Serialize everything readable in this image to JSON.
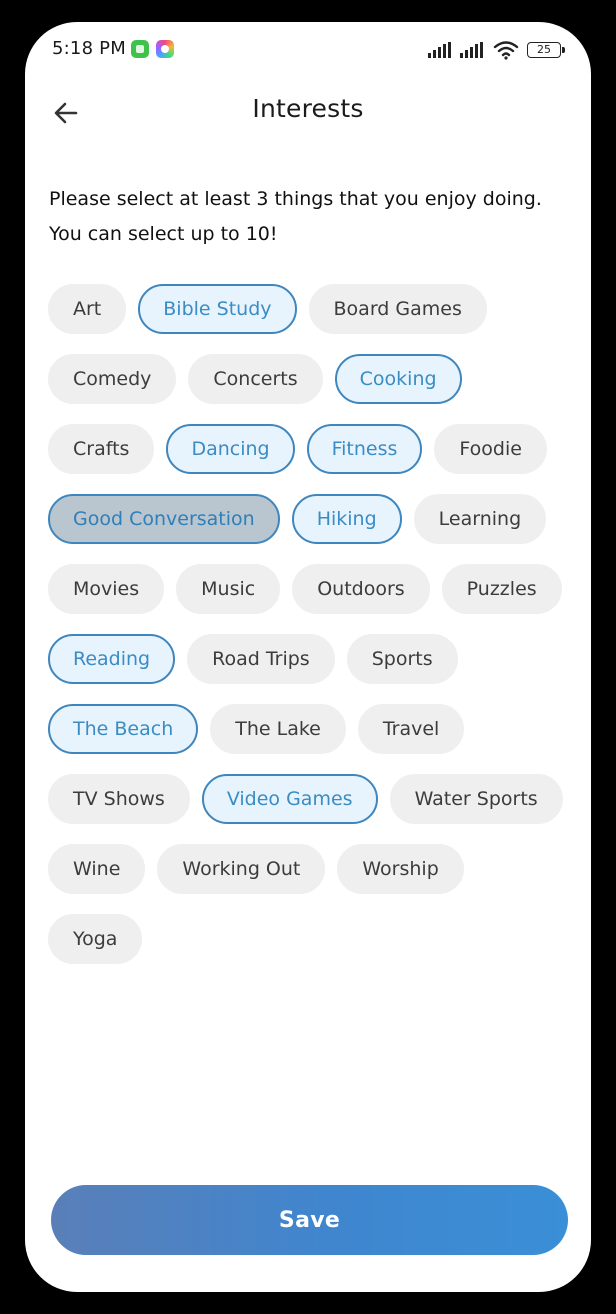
{
  "status_bar": {
    "time": "5:18 PM",
    "battery": "25"
  },
  "header": {
    "title": "Interests"
  },
  "instructions": {
    "line1": "Please select at least 3 things that you enjoy doing.",
    "line2": "You can select up to 10!"
  },
  "interests": [
    {
      "label": "Art",
      "selected": false
    },
    {
      "label": "Bible Study",
      "selected": true
    },
    {
      "label": "Board Games",
      "selected": false
    },
    {
      "label": "Comedy",
      "selected": false
    },
    {
      "label": "Concerts",
      "selected": false
    },
    {
      "label": "Cooking",
      "selected": true
    },
    {
      "label": "Crafts",
      "selected": false
    },
    {
      "label": "Dancing",
      "selected": true
    },
    {
      "label": "Fitness",
      "selected": true
    },
    {
      "label": "Foodie",
      "selected": false
    },
    {
      "label": "Good Conversation",
      "selected": true,
      "focused": true
    },
    {
      "label": "Hiking",
      "selected": true
    },
    {
      "label": "Learning",
      "selected": false
    },
    {
      "label": "Movies",
      "selected": false
    },
    {
      "label": "Music",
      "selected": false
    },
    {
      "label": "Outdoors",
      "selected": false
    },
    {
      "label": "Puzzles",
      "selected": false
    },
    {
      "label": "Reading",
      "selected": true
    },
    {
      "label": "Road Trips",
      "selected": false
    },
    {
      "label": "Sports",
      "selected": false
    },
    {
      "label": "The Beach",
      "selected": true
    },
    {
      "label": "The Lake",
      "selected": false
    },
    {
      "label": "Travel",
      "selected": false
    },
    {
      "label": "TV Shows",
      "selected": false
    },
    {
      "label": "Video Games",
      "selected": true
    },
    {
      "label": "Water Sports",
      "selected": false
    },
    {
      "label": "Wine",
      "selected": false
    },
    {
      "label": "Working Out",
      "selected": false
    },
    {
      "label": "Worship",
      "selected": false
    },
    {
      "label": "Yoga",
      "selected": false
    }
  ],
  "save_label": "Save",
  "colors": {
    "accent": "#3e86bd",
    "selected_bg": "#e8f4fd",
    "chip_bg": "#efefef"
  },
  "icons": {
    "back": "arrow-left-icon",
    "signal": "signal-icon",
    "wifi": "wifi-icon",
    "battery": "battery-icon"
  }
}
